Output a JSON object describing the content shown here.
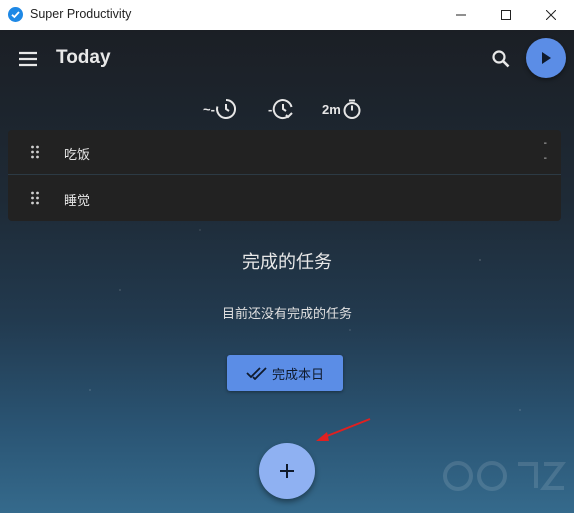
{
  "window": {
    "title": "Super Productivity",
    "icon": "super-productivity-logo"
  },
  "header": {
    "title": "Today",
    "menu_icon": "hamburger-menu-icon",
    "search_icon": "search-icon",
    "play_icon": "play-icon"
  },
  "stats": {
    "estimate_label": "~-",
    "remaining_label": "-",
    "time_spent_label": "2m"
  },
  "tasks": [
    {
      "title": "吃饭",
      "meta_top": "-",
      "meta_bottom": "-"
    },
    {
      "title": "睡觉"
    }
  ],
  "done_section": {
    "heading": "完成的任务",
    "empty_text": "目前还没有完成的任务",
    "finish_day_label": "完成本日"
  },
  "fab": {
    "icon": "plus-icon"
  },
  "colors": {
    "accent": "#5b8de6",
    "fab": "#8fb1f2",
    "annotation_arrow": "#e02020"
  }
}
